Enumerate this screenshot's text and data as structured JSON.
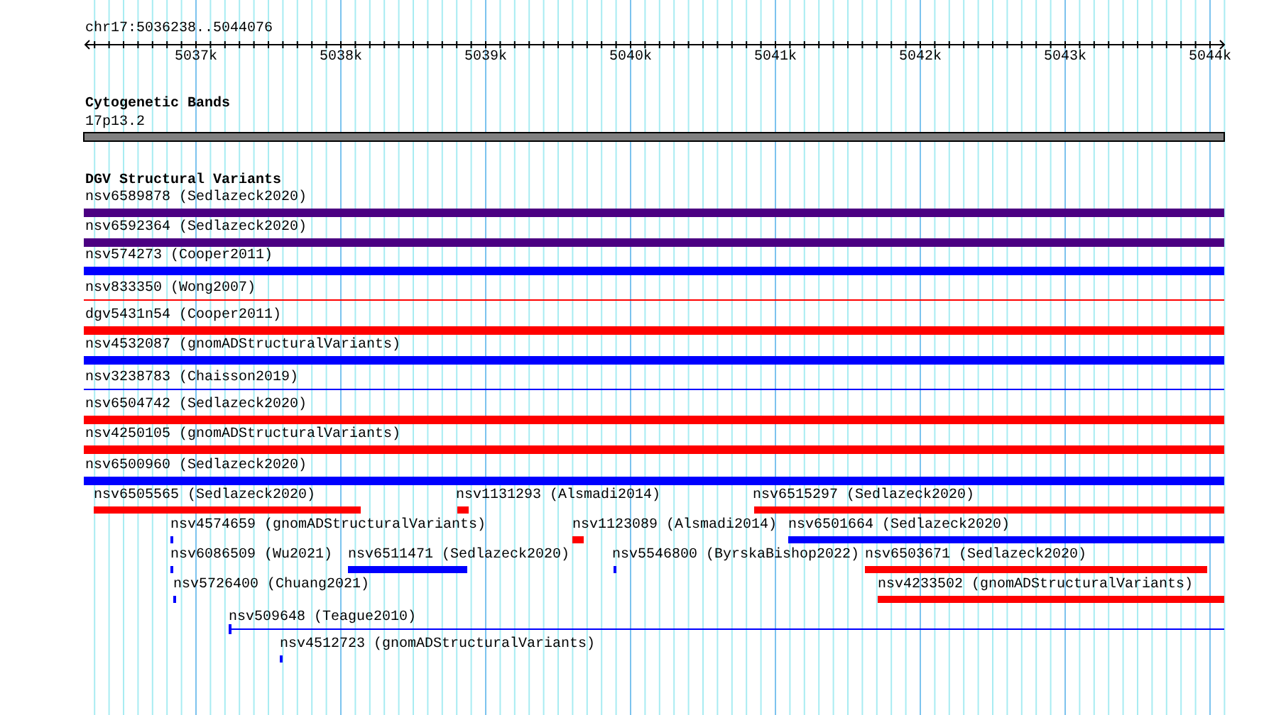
{
  "ruler": {
    "locus": "chr17:5036238..5044076",
    "ticks": [
      "5037k",
      "5038k",
      "5039k",
      "5040k",
      "5041k",
      "5042k",
      "5043k",
      "5044k"
    ]
  },
  "cytoband_track": {
    "title": "Cytogenetic Bands",
    "band": "17p13.2"
  },
  "variant_track": {
    "title": "DGV Structural Variants",
    "features": [
      {
        "label": "nsv6589878 (Sedlazeck2020)",
        "color": "#4b0082",
        "kind": "bar"
      },
      {
        "label": "nsv6592364 (Sedlazeck2020)",
        "color": "#4b0082",
        "kind": "bar"
      },
      {
        "label": "nsv574273 (Cooper2011)",
        "color": "#0000ff",
        "kind": "bar"
      },
      {
        "label": "nsv833350 (Wong2007)",
        "color": "#ff0000",
        "kind": "line"
      },
      {
        "label": "dgv5431n54 (Cooper2011)",
        "color": "#ff0000",
        "kind": "bar"
      },
      {
        "label": "nsv4532087 (gnomADStructuralVariants)",
        "color": "#0000ff",
        "kind": "bar"
      },
      {
        "label": "nsv3238783 (Chaisson2019)",
        "color": "#0000ff",
        "kind": "line"
      },
      {
        "label": "nsv6504742 (Sedlazeck2020)",
        "color": "#ff0000",
        "kind": "bar"
      },
      {
        "label": "nsv4250105 (gnomADStructuralVariants)",
        "color": "#ff0000",
        "kind": "bar"
      },
      {
        "label": "nsv6500960 (Sedlazeck2020)",
        "color": "#0000ff",
        "kind": "bar"
      },
      {
        "label": "nsv6505565 (Sedlazeck2020)",
        "color": "#ff0000",
        "kind": "bar"
      },
      {
        "label": "nsv1131293 (Alsmadi2014)",
        "color": "#ff0000",
        "kind": "bar"
      },
      {
        "label": "nsv6515297 (Sedlazeck2020)",
        "color": "#ff0000",
        "kind": "bar"
      },
      {
        "label": "nsv4574659 (gnomADStructuralVariants)",
        "color": "#0000ff",
        "kind": "bar"
      },
      {
        "label": "nsv1123089 (Alsmadi2014)",
        "color": "#ff0000",
        "kind": "bar"
      },
      {
        "label": "nsv6501664 (Sedlazeck2020)",
        "color": "#0000ff",
        "kind": "bar"
      },
      {
        "label": "nsv6086509 (Wu2021)",
        "color": "#0000ff",
        "kind": "bar"
      },
      {
        "label": "nsv6511471 (Sedlazeck2020)",
        "color": "#0000ff",
        "kind": "bar"
      },
      {
        "label": "nsv5546800 (ByrskaBishop2022)",
        "color": "#0000ff",
        "kind": "bar"
      },
      {
        "label": "nsv6503671 (Sedlazeck2020)",
        "color": "#ff0000",
        "kind": "bar"
      },
      {
        "label": "nsv5726400 (Chuang2021)",
        "color": "#0000ff",
        "kind": "bar"
      },
      {
        "label": "nsv4233502 (gnomADStructuralVariants)",
        "color": "#ff0000",
        "kind": "bar"
      },
      {
        "label": "nsv509648 (Teague2010)",
        "color": "#0000ff",
        "kind": "line"
      },
      {
        "label": "nsv4512723 (gnomADStructuralVariants)",
        "color": "#0000ff",
        "kind": "bar"
      }
    ]
  }
}
